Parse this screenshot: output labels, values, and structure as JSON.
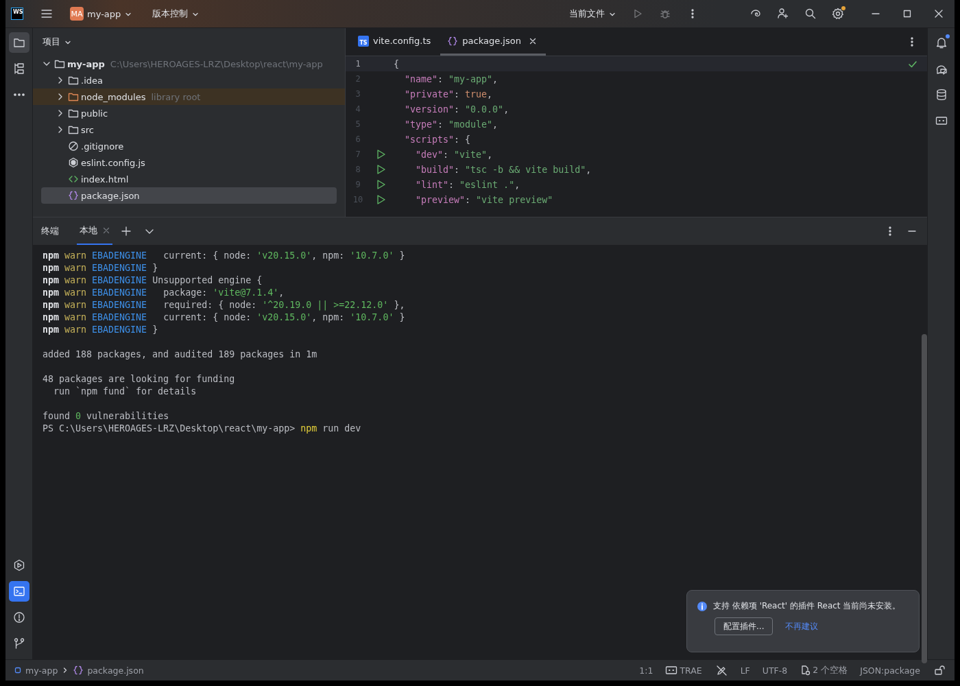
{
  "title_bar": {
    "logo": "WS",
    "project_badge": "MA",
    "project": "my-app",
    "vcs": "版本控制",
    "run_config": "当前文件",
    "run_disabled": true,
    "settings_badge": true
  },
  "left_toolbar": [
    {
      "kind": "project",
      "selected": true
    },
    {
      "kind": "structure",
      "selected": false
    },
    {
      "kind": "more",
      "selected": false
    },
    {
      "kind": "services",
      "selected": false
    },
    {
      "kind": "terminal",
      "selected": true
    },
    {
      "kind": "problems",
      "selected": false
    },
    {
      "kind": "git",
      "selected": false
    }
  ],
  "project_panel": {
    "title": "项目",
    "tree": [
      {
        "name": "my-app",
        "hint": "C:\\Users\\HEROAGES-LRZ\\Desktop\\react\\my-app",
        "kind": "folder",
        "expanded": true,
        "selected": false,
        "children": [
          {
            "name": ".idea",
            "kind": "folder",
            "expanded": false,
            "selected": false
          },
          {
            "name": "node_modules",
            "hint": "library root",
            "kind": "library",
            "expanded": false,
            "selected": false
          },
          {
            "name": "public",
            "kind": "folder",
            "expanded": false,
            "selected": false
          },
          {
            "name": "src",
            "kind": "folder",
            "expanded": false,
            "selected": false
          },
          {
            "name": ".gitignore",
            "kind": "ignore",
            "selected": false
          },
          {
            "name": "eslint.config.js",
            "kind": "eslint",
            "selected": false
          },
          {
            "name": "index.html",
            "kind": "html",
            "selected": false
          },
          {
            "name": "package.json",
            "kind": "json",
            "selected": true
          }
        ]
      }
    ]
  },
  "editor": {
    "tabs": [
      {
        "label": "vite.config.ts",
        "kind": "ts",
        "badge": "TS",
        "selected": false,
        "closable": false
      },
      {
        "label": "package.json",
        "kind": "json",
        "selected": true,
        "closable": true
      }
    ],
    "inspection_ok": true,
    "lines": [
      {
        "number": "1",
        "current": true,
        "runnable": false,
        "tokens": [
          {
            "kind": "punct",
            "text": "{"
          }
        ]
      },
      {
        "number": "2",
        "current": false,
        "runnable": false,
        "tokens": [
          {
            "kind": "key",
            "text": "  \"name\""
          },
          {
            "kind": "punct",
            "text": ": "
          },
          {
            "kind": "str",
            "text": "\"my-app\""
          },
          {
            "kind": "punct",
            "text": ","
          }
        ]
      },
      {
        "number": "3",
        "current": false,
        "runnable": false,
        "tokens": [
          {
            "kind": "key",
            "text": "  \"private\""
          },
          {
            "kind": "punct",
            "text": ": "
          },
          {
            "kind": "bool",
            "text": "true"
          },
          {
            "kind": "punct",
            "text": ","
          }
        ]
      },
      {
        "number": "4",
        "current": false,
        "runnable": false,
        "tokens": [
          {
            "kind": "key",
            "text": "  \"version\""
          },
          {
            "kind": "punct",
            "text": ": "
          },
          {
            "kind": "str",
            "text": "\"0.0.0\""
          },
          {
            "kind": "punct",
            "text": ","
          }
        ]
      },
      {
        "number": "5",
        "current": false,
        "runnable": false,
        "tokens": [
          {
            "kind": "key",
            "text": "  \"type\""
          },
          {
            "kind": "punct",
            "text": ": "
          },
          {
            "kind": "str",
            "text": "\"module\""
          },
          {
            "kind": "punct",
            "text": ","
          }
        ]
      },
      {
        "number": "6",
        "current": false,
        "runnable": false,
        "tokens": [
          {
            "kind": "key",
            "text": "  \"scripts\""
          },
          {
            "kind": "punct",
            "text": ": {"
          }
        ]
      },
      {
        "number": "7",
        "current": false,
        "runnable": true,
        "tokens": [
          {
            "kind": "key",
            "text": "    \"dev\""
          },
          {
            "kind": "punct",
            "text": ": "
          },
          {
            "kind": "str",
            "text": "\"vite\""
          },
          {
            "kind": "punct",
            "text": ","
          }
        ]
      },
      {
        "number": "8",
        "current": false,
        "runnable": true,
        "tokens": [
          {
            "kind": "key",
            "text": "    \"build\""
          },
          {
            "kind": "punct",
            "text": ": "
          },
          {
            "kind": "str",
            "text": "\"tsc -b && vite build\""
          },
          {
            "kind": "punct",
            "text": ","
          }
        ]
      },
      {
        "number": "9",
        "current": false,
        "runnable": true,
        "tokens": [
          {
            "kind": "key",
            "text": "    \"lint\""
          },
          {
            "kind": "punct",
            "text": ": "
          },
          {
            "kind": "str",
            "text": "\"eslint .\""
          },
          {
            "kind": "punct",
            "text": ","
          }
        ]
      },
      {
        "number": "10",
        "current": false,
        "runnable": true,
        "tokens": [
          {
            "kind": "key",
            "text": "    \"preview\""
          },
          {
            "kind": "punct",
            "text": ": "
          },
          {
            "kind": "str",
            "text": "\"vite preview\""
          }
        ]
      }
    ]
  },
  "right_toolbar": [
    {
      "kind": "notifications",
      "badge": true
    },
    {
      "kind": "ai-chat",
      "badge": false
    },
    {
      "kind": "database",
      "badge": false
    },
    {
      "kind": "trae",
      "badge": false
    }
  ],
  "terminal": {
    "title": "终端",
    "tabs": [
      {
        "label": "本地",
        "selected": true,
        "closable": true
      }
    ],
    "lines": [
      {
        "kind": "text",
        "tokens": [
          {
            "kind": "npm",
            "text": "npm "
          },
          {
            "kind": "warn",
            "text": "warn "
          },
          {
            "kind": "code",
            "text": "EBADENGINE"
          },
          {
            "kind": "plain",
            "text": "   current: { node: "
          },
          {
            "kind": "str",
            "text": "'v20.15.0'"
          },
          {
            "kind": "plain",
            "text": ", npm: "
          },
          {
            "kind": "str",
            "text": "'10.7.0'"
          },
          {
            "kind": "plain",
            "text": " }"
          }
        ]
      },
      {
        "kind": "text",
        "tokens": [
          {
            "kind": "npm",
            "text": "npm "
          },
          {
            "kind": "warn",
            "text": "warn "
          },
          {
            "kind": "code",
            "text": "EBADENGINE"
          },
          {
            "kind": "plain",
            "text": " }"
          }
        ]
      },
      {
        "kind": "text",
        "tokens": [
          {
            "kind": "npm",
            "text": "npm "
          },
          {
            "kind": "warn",
            "text": "warn "
          },
          {
            "kind": "code",
            "text": "EBADENGINE"
          },
          {
            "kind": "plain",
            "text": " Unsupported engine {"
          }
        ]
      },
      {
        "kind": "text",
        "tokens": [
          {
            "kind": "npm",
            "text": "npm "
          },
          {
            "kind": "warn",
            "text": "warn "
          },
          {
            "kind": "code",
            "text": "EBADENGINE"
          },
          {
            "kind": "plain",
            "text": "   package: "
          },
          {
            "kind": "str",
            "text": "'vite@7.1.4'"
          },
          {
            "kind": "plain",
            "text": ","
          }
        ]
      },
      {
        "kind": "text",
        "tokens": [
          {
            "kind": "npm",
            "text": "npm "
          },
          {
            "kind": "warn",
            "text": "warn "
          },
          {
            "kind": "code",
            "text": "EBADENGINE"
          },
          {
            "kind": "plain",
            "text": "   required: { node: "
          },
          {
            "kind": "str",
            "text": "'^20.19.0 || >=22.12.0'"
          },
          {
            "kind": "plain",
            "text": " },"
          }
        ]
      },
      {
        "kind": "text",
        "tokens": [
          {
            "kind": "npm",
            "text": "npm "
          },
          {
            "kind": "warn",
            "text": "warn "
          },
          {
            "kind": "code",
            "text": "EBADENGINE"
          },
          {
            "kind": "plain",
            "text": "   current: { node: "
          },
          {
            "kind": "str",
            "text": "'v20.15.0'"
          },
          {
            "kind": "plain",
            "text": ", npm: "
          },
          {
            "kind": "str",
            "text": "'10.7.0'"
          },
          {
            "kind": "plain",
            "text": " }"
          }
        ]
      },
      {
        "kind": "text",
        "tokens": [
          {
            "kind": "npm",
            "text": "npm "
          },
          {
            "kind": "warn",
            "text": "warn "
          },
          {
            "kind": "code",
            "text": "EBADENGINE"
          },
          {
            "kind": "plain",
            "text": " }"
          }
        ]
      },
      {
        "kind": "blank"
      },
      {
        "kind": "text",
        "tokens": [
          {
            "kind": "plain",
            "text": "added 188 packages, and audited 189 packages in 1m"
          }
        ]
      },
      {
        "kind": "blank"
      },
      {
        "kind": "text",
        "tokens": [
          {
            "kind": "plain",
            "text": "48 packages are looking for funding"
          }
        ]
      },
      {
        "kind": "text",
        "tokens": [
          {
            "kind": "plain",
            "text": "  run `npm fund` for details"
          }
        ]
      },
      {
        "kind": "blank"
      },
      {
        "kind": "text",
        "tokens": [
          {
            "kind": "plain",
            "text": "found "
          },
          {
            "kind": "str",
            "text": "0"
          },
          {
            "kind": "plain",
            "text": " vulnerabilities"
          }
        ]
      },
      {
        "kind": "text",
        "tokens": [
          {
            "kind": "plain",
            "text": "PS C:\\Users\\HEROAGES-LRZ\\Desktop\\react\\my-app> "
          },
          {
            "kind": "cmd",
            "text": "npm"
          },
          {
            "kind": "plain",
            "text": " run dev"
          }
        ]
      }
    ]
  },
  "notification": {
    "message": "支持 依赖项 'React' 的插件 React 当前尚未安装。",
    "button": "配置插件...",
    "link": "不再建议"
  },
  "status_bar": {
    "breadcrumbs": [
      {
        "kind": "module",
        "text": "my-app"
      },
      {
        "kind": "json",
        "text": "package.json"
      }
    ],
    "items": [
      {
        "kind": "text",
        "text": "1:1"
      },
      {
        "kind": "trae",
        "text": "TRAE"
      },
      {
        "kind": "readonly-off"
      },
      {
        "kind": "text",
        "text": "LF"
      },
      {
        "kind": "text",
        "text": "UTF-8"
      },
      {
        "kind": "indent",
        "text": "2 个空格"
      },
      {
        "kind": "text",
        "text": "JSON:package"
      },
      {
        "kind": "lock"
      }
    ]
  }
}
